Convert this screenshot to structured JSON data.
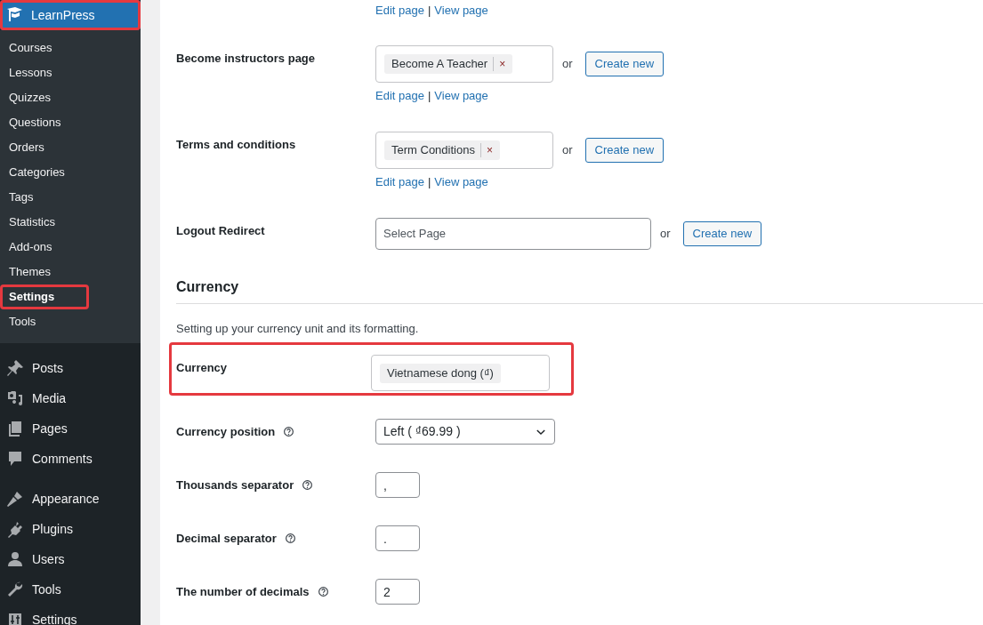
{
  "sidebar": {
    "current": {
      "label": "LearnPress",
      "highlighted": true
    },
    "submenu": [
      {
        "label": "Courses",
        "selected": false,
        "highlighted": false
      },
      {
        "label": "Lessons",
        "selected": false,
        "highlighted": false
      },
      {
        "label": "Quizzes",
        "selected": false,
        "highlighted": false
      },
      {
        "label": "Questions",
        "selected": false,
        "highlighted": false
      },
      {
        "label": "Orders",
        "selected": false,
        "highlighted": false
      },
      {
        "label": "Categories",
        "selected": false,
        "highlighted": false
      },
      {
        "label": "Tags",
        "selected": false,
        "highlighted": false
      },
      {
        "label": "Statistics",
        "selected": false,
        "highlighted": false
      },
      {
        "label": "Add-ons",
        "selected": false,
        "highlighted": false
      },
      {
        "label": "Themes",
        "selected": false,
        "highlighted": false
      },
      {
        "label": "Settings",
        "selected": true,
        "highlighted": true
      },
      {
        "label": "Tools",
        "selected": false,
        "highlighted": false
      }
    ],
    "menu_groups": [
      [
        {
          "label": "Posts"
        },
        {
          "label": "Media"
        },
        {
          "label": "Pages"
        },
        {
          "label": "Comments"
        }
      ],
      [
        {
          "label": "Appearance"
        },
        {
          "label": "Plugins"
        },
        {
          "label": "Users"
        },
        {
          "label": "Tools"
        },
        {
          "label": "Settings"
        }
      ]
    ]
  },
  "content": [
    {
      "kind": "links",
      "links": [
        "Edit page",
        "View page"
      ],
      "divider": "|"
    },
    {
      "kind": "page_select",
      "label": "Become instructors page",
      "value": "Become A Teacher",
      "remove": "×",
      "or": "or",
      "button": "Create new",
      "links": [
        "Edit page",
        "View page"
      ],
      "divider": "|"
    },
    {
      "kind": "page_select",
      "label": "Terms and conditions",
      "value": "Term Conditions",
      "remove": "×",
      "or": "or",
      "button": "Create new",
      "links": [
        "Edit page",
        "View page"
      ],
      "divider": "|"
    },
    {
      "kind": "empty_select",
      "label": "Logout Redirect",
      "placeholder": "Select Page",
      "or": "or",
      "button": "Create new"
    },
    {
      "kind": "heading",
      "text": "Currency"
    },
    {
      "kind": "description",
      "text": "Setting up your currency unit and its formatting."
    },
    {
      "kind": "tag_field",
      "label": "Currency",
      "value": "Vietnamese dong (₫)",
      "highlighted": true
    },
    {
      "kind": "dropdown",
      "label": "Currency position",
      "value": "Left ( ₫69.99 )"
    },
    {
      "kind": "text",
      "label": "Thousands separator",
      "value": ","
    },
    {
      "kind": "text",
      "label": "Decimal separator",
      "value": "."
    },
    {
      "kind": "text",
      "label": "The number of decimals",
      "value": "2"
    }
  ]
}
